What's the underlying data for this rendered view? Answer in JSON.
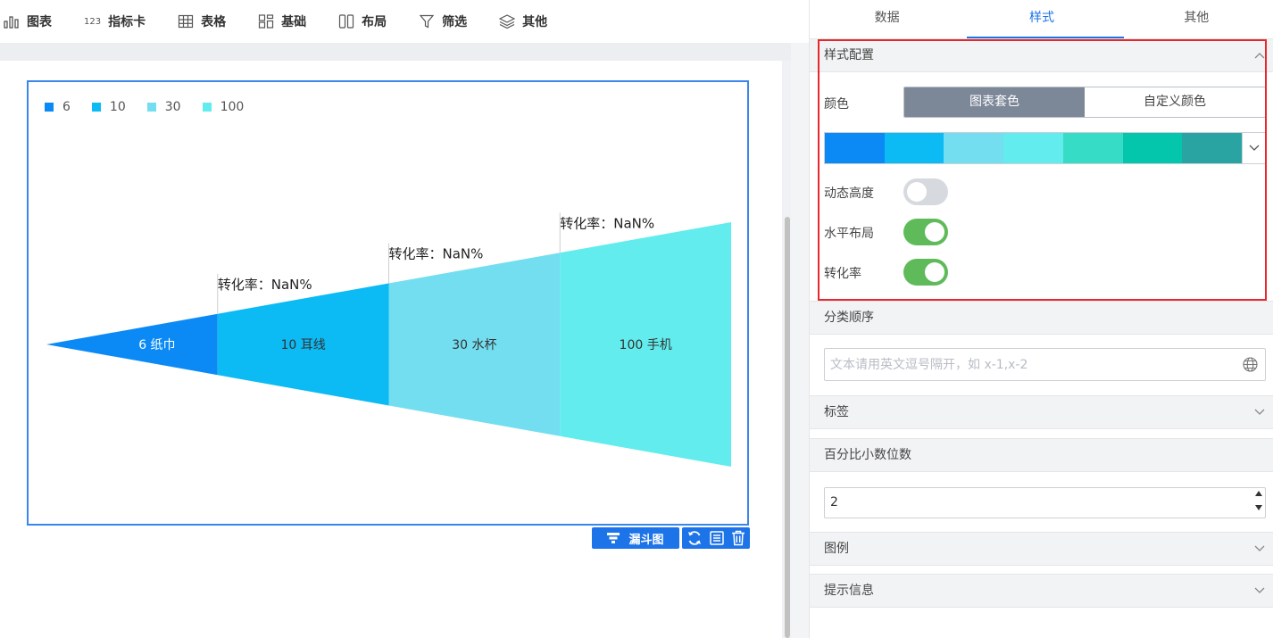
{
  "toolbar": {
    "items": [
      {
        "label": "图表",
        "icon": "bar-chart-icon"
      },
      {
        "label": "指标卡",
        "icon": "number-card-icon",
        "badge": "123"
      },
      {
        "label": "表格",
        "icon": "table-grid-icon"
      },
      {
        "label": "基础",
        "icon": "basic-widgets-icon"
      },
      {
        "label": "布局",
        "icon": "layout-columns-icon"
      },
      {
        "label": "筛选",
        "icon": "filter-funnel-icon"
      },
      {
        "label": "其他",
        "icon": "layers-icon"
      }
    ]
  },
  "chart_widget": {
    "type_button_label": "漏斗图",
    "actions": [
      "refresh-icon",
      "data-list-icon",
      "delete-icon"
    ]
  },
  "chart_data": {
    "type": "funnel-horizontal",
    "legend": [
      "6",
      "10",
      "30",
      "100"
    ],
    "legend_position": "top-left",
    "stages": [
      {
        "name": "纸巾",
        "value": 6,
        "label": "6 纸巾",
        "color": "#0b8af5"
      },
      {
        "name": "耳线",
        "value": 10,
        "label": "10 耳线",
        "color": "#0cbaf4"
      },
      {
        "name": "水杯",
        "value": 30,
        "label": "30 水杯",
        "color": "#73def0"
      },
      {
        "name": "手机",
        "value": 100,
        "label": "100 手机",
        "color": "#62eced"
      }
    ],
    "conversion_labels": [
      "转化率：NaN%",
      "转化率：NaN%",
      "转化率：NaN%"
    ]
  },
  "panel": {
    "tabs": [
      "数据",
      "样式",
      "其他"
    ],
    "active_tab": "样式",
    "style_config": {
      "title": "样式配置",
      "color_label": "颜色",
      "color_modes": [
        "图表套色",
        "自定义颜色"
      ],
      "active_color_mode": "图表套色",
      "palette": [
        "#0b8af5",
        "#0cbaf4",
        "#73def0",
        "#62eced",
        "#36dcc6",
        "#04c6ad",
        "#2aa3a3"
      ],
      "dynamic_height_label": "动态高度",
      "dynamic_height_on": false,
      "horizontal_layout_label": "水平布局",
      "horizontal_layout_on": true,
      "conversion_rate_label": "转化率",
      "conversion_rate_on": true
    },
    "category_order": {
      "title": "分类顺序",
      "placeholder": "文本请用英文逗号隔开，如 x-1,x-2"
    },
    "labels_section": "标签",
    "percent_decimals": {
      "title": "百分比小数位数",
      "value": "2"
    },
    "legend_section": "图例",
    "tooltip_section": "提示信息"
  }
}
